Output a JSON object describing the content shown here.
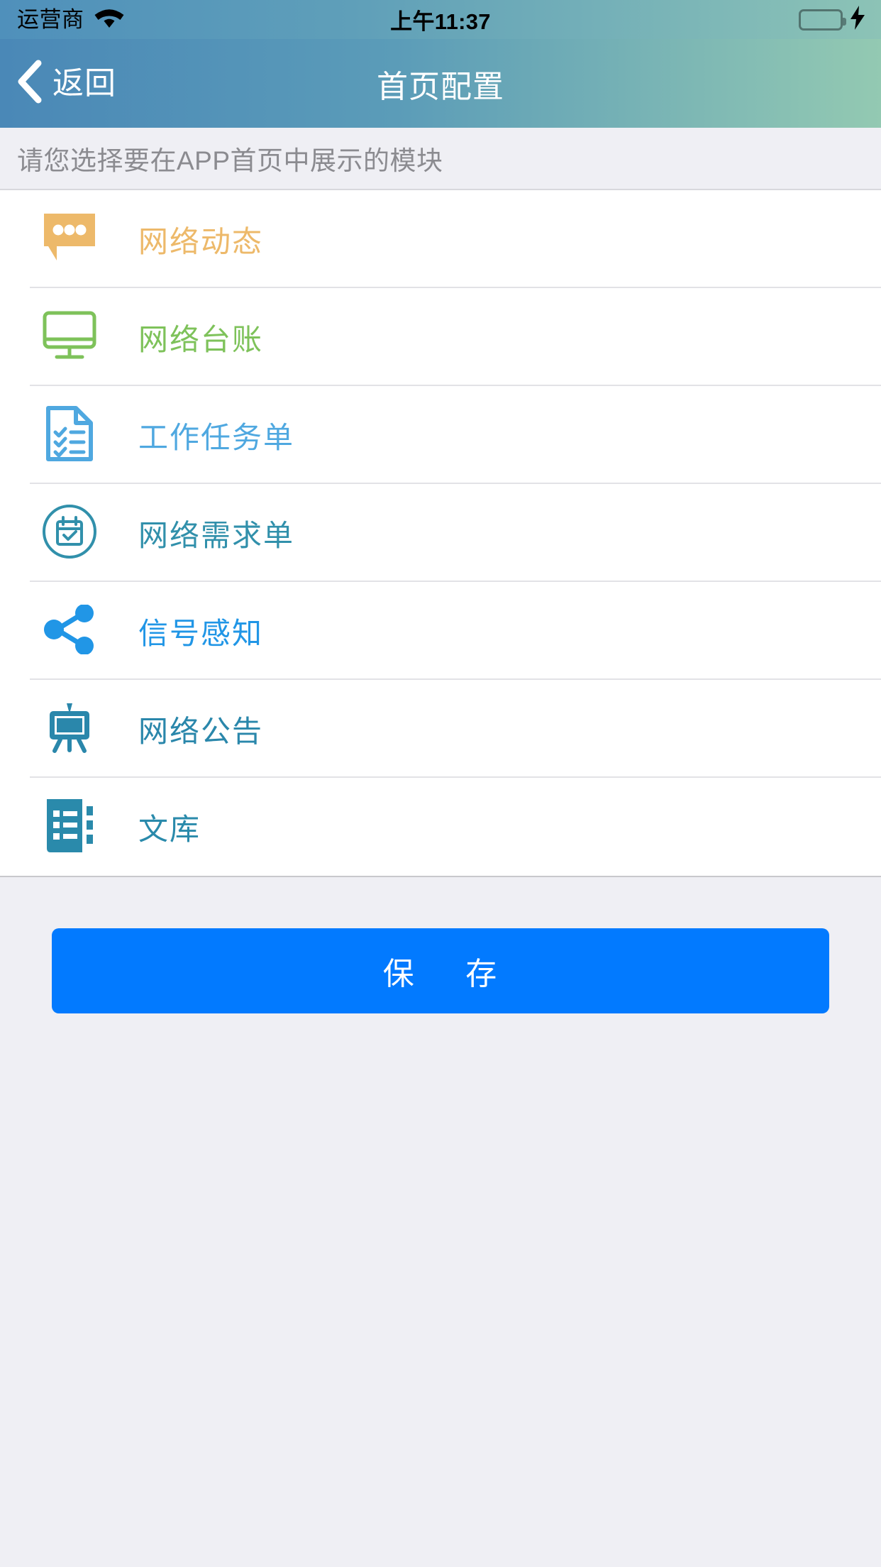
{
  "status_bar": {
    "carrier": "运营商",
    "wifi_icon": "wifi-icon",
    "time": "上午11:37",
    "battery_icon": "battery-icon",
    "charging_icon": "lightning-bolt-icon",
    "battery_color": "#4cd964"
  },
  "nav_bar": {
    "back_icon": "chevron-left-icon",
    "back_label": "返回",
    "title": "首页配置",
    "gradient_from": "#4a88b7",
    "gradient_to": "#93c9b2"
  },
  "subtitle": {
    "text": "请您选择要在APP首页中展示的模块",
    "color": "#8b8b90"
  },
  "modules": [
    {
      "label": "网络动态",
      "icon": "speech-bubble-dots-icon",
      "color": "#edb96a"
    },
    {
      "label": "网络台账",
      "icon": "desktop-monitor-icon",
      "color": "#7ec25a"
    },
    {
      "label": "工作任务单",
      "icon": "document-checklist-icon",
      "color": "#4fa8e0"
    },
    {
      "label": "网络需求单",
      "icon": "calendar-circle-icon",
      "color": "#3190ab"
    },
    {
      "label": "信号感知",
      "icon": "share-network-icon",
      "color": "#2196e6"
    },
    {
      "label": "网络公告",
      "icon": "easel-board-icon",
      "color": "#2a87ab"
    },
    {
      "label": "文库",
      "icon": "book-list-icon",
      "color": "#2a8aab"
    }
  ],
  "footer": {
    "save_label_part1": "保",
    "save_label_part2": "存",
    "save_color": "#027aff"
  }
}
